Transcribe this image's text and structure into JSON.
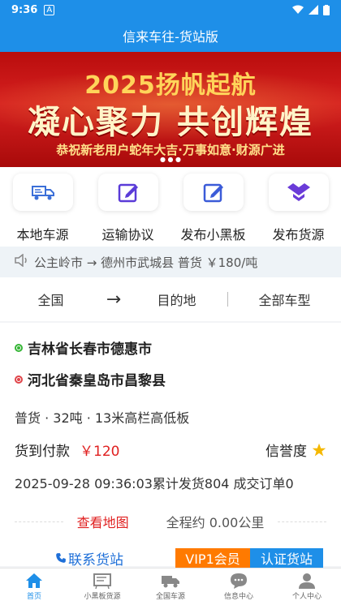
{
  "statusbar": {
    "time": "9:36"
  },
  "title": "信来车往-货站版",
  "banner": {
    "line1": "2025扬帆起航",
    "line2": "凝心聚力 共创辉煌",
    "line3": "恭祝新老用户蛇年大吉·万事如意·财源广进"
  },
  "actions": [
    {
      "label": "本地车源",
      "icon": "truck-icon"
    },
    {
      "label": "运输协议",
      "icon": "edit-icon"
    },
    {
      "label": "发布小黑板",
      "icon": "edit-icon"
    },
    {
      "label": "发布货源",
      "icon": "dropbox-icon"
    }
  ],
  "notice": {
    "text": "公主岭市 → 德州市武城县 普货 ￥180/吨"
  },
  "filter": {
    "from": "全国",
    "arrow": "→",
    "to": "目的地",
    "vehicle_type": "全部车型"
  },
  "cargo": {
    "origin": "吉林省长春市德惠市",
    "destination": "河北省秦皇岛市昌黎县",
    "spec": "普货 · 32吨 · 13米高栏高低板",
    "payment": "货到付款",
    "price": "￥120",
    "credit_label": "信誉度",
    "stats": "2025-09-28 09:36:03累计发货804 成交订单0",
    "view_map": "查看地图",
    "distance": "全程约 0.00公里",
    "contact": "联系货站",
    "vip": "VIP1会员",
    "certified": "认证货站"
  },
  "tabs": [
    {
      "label": "首页",
      "active": true
    },
    {
      "label": "小黑板货源",
      "active": false
    },
    {
      "label": "全国车源",
      "active": false
    },
    {
      "label": "信息中心",
      "active": false
    },
    {
      "label": "个人中心",
      "active": false
    }
  ],
  "colors": {
    "primary": "#1e8fe8",
    "price": "#e02020",
    "vip": "#ff7a00",
    "banner": "#c41414"
  }
}
